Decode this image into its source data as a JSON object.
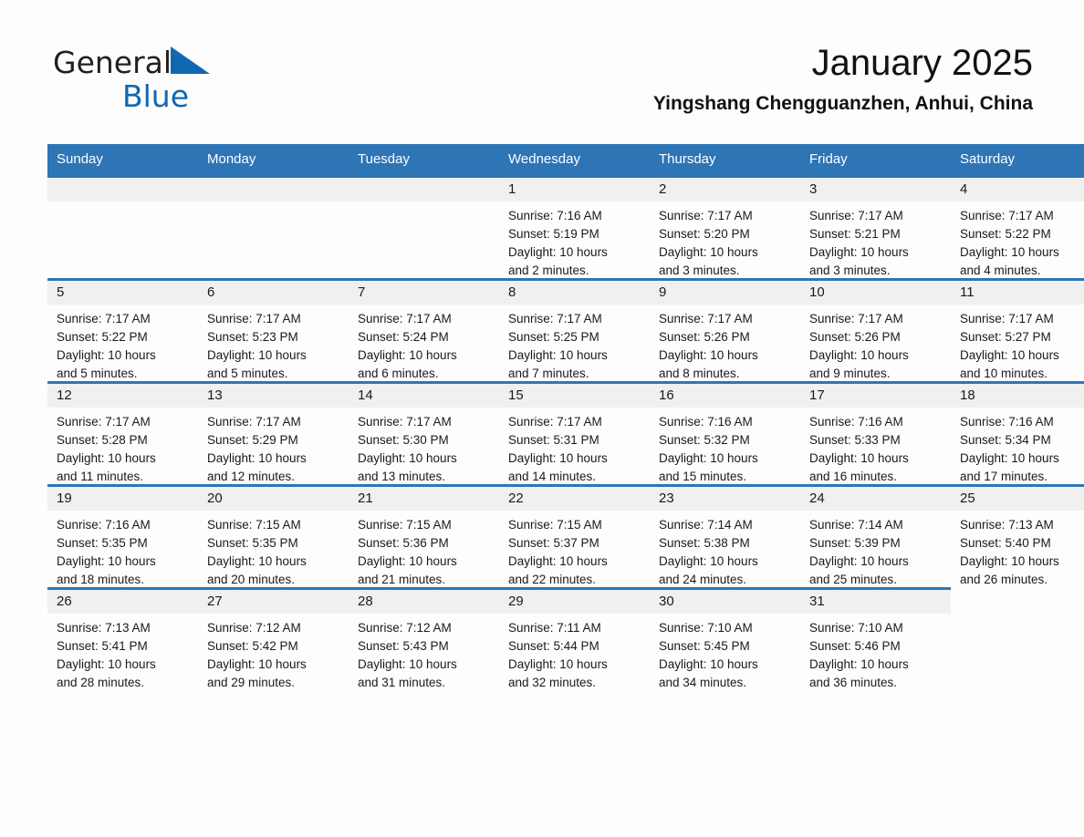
{
  "brand": {
    "word1": "General",
    "word2": "Blue",
    "triangle_color": "#1167b1"
  },
  "header": {
    "title": "January 2025",
    "subtitle": "Yingshang Chengguanzhen, Anhui, China"
  },
  "theme": {
    "header_blue": "#2e75b6",
    "daynum_band": "#f0f0f0",
    "page_bg": "#fdfdfd",
    "text": "#1a1a1a"
  },
  "calendar": {
    "weekday_headers": [
      "Sunday",
      "Monday",
      "Tuesday",
      "Wednesday",
      "Thursday",
      "Friday",
      "Saturday"
    ],
    "weeks": [
      [
        {
          "day": "",
          "blank": true,
          "sunrise": "",
          "sunset": "",
          "daylight_line1": "",
          "daylight_line2": ""
        },
        {
          "day": "",
          "blank": true,
          "sunrise": "",
          "sunset": "",
          "daylight_line1": "",
          "daylight_line2": ""
        },
        {
          "day": "",
          "blank": true,
          "sunrise": "",
          "sunset": "",
          "daylight_line1": "",
          "daylight_line2": ""
        },
        {
          "day": "1",
          "blank": false,
          "sunrise": "Sunrise: 7:16 AM",
          "sunset": "Sunset: 5:19 PM",
          "daylight_line1": "Daylight: 10 hours",
          "daylight_line2": "and 2 minutes."
        },
        {
          "day": "2",
          "blank": false,
          "sunrise": "Sunrise: 7:17 AM",
          "sunset": "Sunset: 5:20 PM",
          "daylight_line1": "Daylight: 10 hours",
          "daylight_line2": "and 3 minutes."
        },
        {
          "day": "3",
          "blank": false,
          "sunrise": "Sunrise: 7:17 AM",
          "sunset": "Sunset: 5:21 PM",
          "daylight_line1": "Daylight: 10 hours",
          "daylight_line2": "and 3 minutes."
        },
        {
          "day": "4",
          "blank": false,
          "sunrise": "Sunrise: 7:17 AM",
          "sunset": "Sunset: 5:22 PM",
          "daylight_line1": "Daylight: 10 hours",
          "daylight_line2": "and 4 minutes."
        }
      ],
      [
        {
          "day": "5",
          "blank": false,
          "sunrise": "Sunrise: 7:17 AM",
          "sunset": "Sunset: 5:22 PM",
          "daylight_line1": "Daylight: 10 hours",
          "daylight_line2": "and 5 minutes."
        },
        {
          "day": "6",
          "blank": false,
          "sunrise": "Sunrise: 7:17 AM",
          "sunset": "Sunset: 5:23 PM",
          "daylight_line1": "Daylight: 10 hours",
          "daylight_line2": "and 5 minutes."
        },
        {
          "day": "7",
          "blank": false,
          "sunrise": "Sunrise: 7:17 AM",
          "sunset": "Sunset: 5:24 PM",
          "daylight_line1": "Daylight: 10 hours",
          "daylight_line2": "and 6 minutes."
        },
        {
          "day": "8",
          "blank": false,
          "sunrise": "Sunrise: 7:17 AM",
          "sunset": "Sunset: 5:25 PM",
          "daylight_line1": "Daylight: 10 hours",
          "daylight_line2": "and 7 minutes."
        },
        {
          "day": "9",
          "blank": false,
          "sunrise": "Sunrise: 7:17 AM",
          "sunset": "Sunset: 5:26 PM",
          "daylight_line1": "Daylight: 10 hours",
          "daylight_line2": "and 8 minutes."
        },
        {
          "day": "10",
          "blank": false,
          "sunrise": "Sunrise: 7:17 AM",
          "sunset": "Sunset: 5:26 PM",
          "daylight_line1": "Daylight: 10 hours",
          "daylight_line2": "and 9 minutes."
        },
        {
          "day": "11",
          "blank": false,
          "sunrise": "Sunrise: 7:17 AM",
          "sunset": "Sunset: 5:27 PM",
          "daylight_line1": "Daylight: 10 hours",
          "daylight_line2": "and 10 minutes."
        }
      ],
      [
        {
          "day": "12",
          "blank": false,
          "sunrise": "Sunrise: 7:17 AM",
          "sunset": "Sunset: 5:28 PM",
          "daylight_line1": "Daylight: 10 hours",
          "daylight_line2": "and 11 minutes."
        },
        {
          "day": "13",
          "blank": false,
          "sunrise": "Sunrise: 7:17 AM",
          "sunset": "Sunset: 5:29 PM",
          "daylight_line1": "Daylight: 10 hours",
          "daylight_line2": "and 12 minutes."
        },
        {
          "day": "14",
          "blank": false,
          "sunrise": "Sunrise: 7:17 AM",
          "sunset": "Sunset: 5:30 PM",
          "daylight_line1": "Daylight: 10 hours",
          "daylight_line2": "and 13 minutes."
        },
        {
          "day": "15",
          "blank": false,
          "sunrise": "Sunrise: 7:17 AM",
          "sunset": "Sunset: 5:31 PM",
          "daylight_line1": "Daylight: 10 hours",
          "daylight_line2": "and 14 minutes."
        },
        {
          "day": "16",
          "blank": false,
          "sunrise": "Sunrise: 7:16 AM",
          "sunset": "Sunset: 5:32 PM",
          "daylight_line1": "Daylight: 10 hours",
          "daylight_line2": "and 15 minutes."
        },
        {
          "day": "17",
          "blank": false,
          "sunrise": "Sunrise: 7:16 AM",
          "sunset": "Sunset: 5:33 PM",
          "daylight_line1": "Daylight: 10 hours",
          "daylight_line2": "and 16 minutes."
        },
        {
          "day": "18",
          "blank": false,
          "sunrise": "Sunrise: 7:16 AM",
          "sunset": "Sunset: 5:34 PM",
          "daylight_line1": "Daylight: 10 hours",
          "daylight_line2": "and 17 minutes."
        }
      ],
      [
        {
          "day": "19",
          "blank": false,
          "sunrise": "Sunrise: 7:16 AM",
          "sunset": "Sunset: 5:35 PM",
          "daylight_line1": "Daylight: 10 hours",
          "daylight_line2": "and 18 minutes."
        },
        {
          "day": "20",
          "blank": false,
          "sunrise": "Sunrise: 7:15 AM",
          "sunset": "Sunset: 5:35 PM",
          "daylight_line1": "Daylight: 10 hours",
          "daylight_line2": "and 20 minutes."
        },
        {
          "day": "21",
          "blank": false,
          "sunrise": "Sunrise: 7:15 AM",
          "sunset": "Sunset: 5:36 PM",
          "daylight_line1": "Daylight: 10 hours",
          "daylight_line2": "and 21 minutes."
        },
        {
          "day": "22",
          "blank": false,
          "sunrise": "Sunrise: 7:15 AM",
          "sunset": "Sunset: 5:37 PM",
          "daylight_line1": "Daylight: 10 hours",
          "daylight_line2": "and 22 minutes."
        },
        {
          "day": "23",
          "blank": false,
          "sunrise": "Sunrise: 7:14 AM",
          "sunset": "Sunset: 5:38 PM",
          "daylight_line1": "Daylight: 10 hours",
          "daylight_line2": "and 24 minutes."
        },
        {
          "day": "24",
          "blank": false,
          "sunrise": "Sunrise: 7:14 AM",
          "sunset": "Sunset: 5:39 PM",
          "daylight_line1": "Daylight: 10 hours",
          "daylight_line2": "and 25 minutes."
        },
        {
          "day": "25",
          "blank": false,
          "sunrise": "Sunrise: 7:13 AM",
          "sunset": "Sunset: 5:40 PM",
          "daylight_line1": "Daylight: 10 hours",
          "daylight_line2": "and 26 minutes."
        }
      ],
      [
        {
          "day": "26",
          "blank": false,
          "sunrise": "Sunrise: 7:13 AM",
          "sunset": "Sunset: 5:41 PM",
          "daylight_line1": "Daylight: 10 hours",
          "daylight_line2": "and 28 minutes."
        },
        {
          "day": "27",
          "blank": false,
          "sunrise": "Sunrise: 7:12 AM",
          "sunset": "Sunset: 5:42 PM",
          "daylight_line1": "Daylight: 10 hours",
          "daylight_line2": "and 29 minutes."
        },
        {
          "day": "28",
          "blank": false,
          "sunrise": "Sunrise: 7:12 AM",
          "sunset": "Sunset: 5:43 PM",
          "daylight_line1": "Daylight: 10 hours",
          "daylight_line2": "and 31 minutes."
        },
        {
          "day": "29",
          "blank": false,
          "sunrise": "Sunrise: 7:11 AM",
          "sunset": "Sunset: 5:44 PM",
          "daylight_line1": "Daylight: 10 hours",
          "daylight_line2": "and 32 minutes."
        },
        {
          "day": "30",
          "blank": false,
          "sunrise": "Sunrise: 7:10 AM",
          "sunset": "Sunset: 5:45 PM",
          "daylight_line1": "Daylight: 10 hours",
          "daylight_line2": "and 34 minutes."
        },
        {
          "day": "31",
          "blank": false,
          "sunrise": "Sunrise: 7:10 AM",
          "sunset": "Sunset: 5:46 PM",
          "daylight_line1": "Daylight: 10 hours",
          "daylight_line2": "and 36 minutes."
        },
        {
          "day": "",
          "blank": true,
          "empty_trailing": true,
          "sunrise": "",
          "sunset": "",
          "daylight_line1": "",
          "daylight_line2": ""
        }
      ]
    ]
  }
}
